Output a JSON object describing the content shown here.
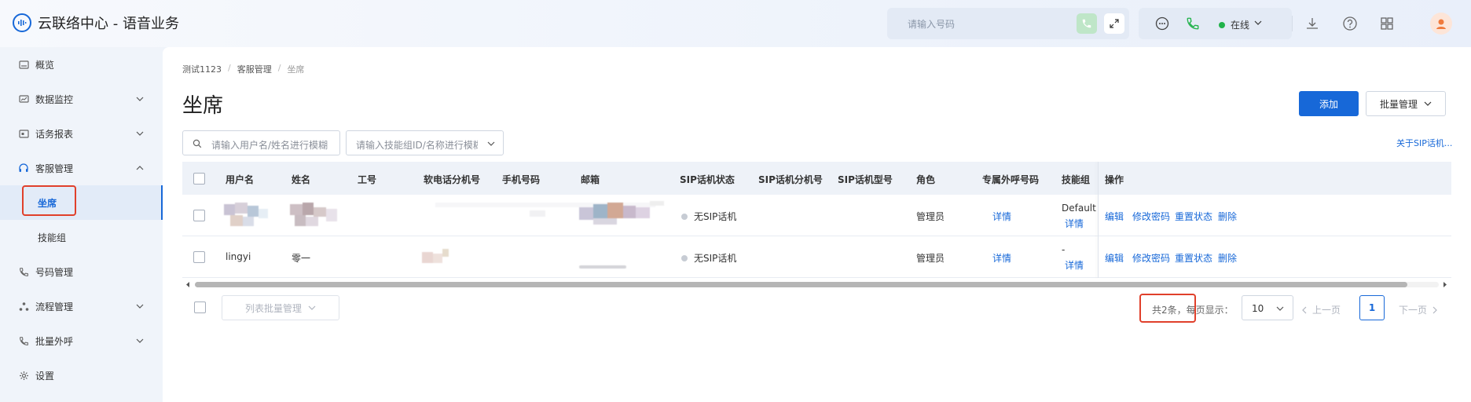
{
  "app": {
    "title": "云联络中心 - 语音业务"
  },
  "topbar": {
    "search_placeholder": "请输入号码",
    "status": "在线"
  },
  "sidebar": {
    "items": [
      {
        "label": "概览",
        "icon": "overview-icon"
      },
      {
        "label": "数据监控",
        "icon": "monitor-icon"
      },
      {
        "label": "话务报表",
        "icon": "report-icon"
      },
      {
        "label": "客服管理",
        "icon": "headset-icon"
      },
      {
        "label": "坐席"
      },
      {
        "label": "技能组"
      },
      {
        "label": "号码管理",
        "icon": "phone-icon"
      },
      {
        "label": "流程管理",
        "icon": "flow-icon"
      },
      {
        "label": "批量外呼",
        "icon": "outbound-icon"
      },
      {
        "label": "设置",
        "icon": "gear-icon"
      }
    ]
  },
  "breadcrumb": [
    "测试1123",
    "客服管理",
    "坐席"
  ],
  "page": {
    "title": "坐席",
    "add_label": "添加",
    "batch_label": "批量管理",
    "filter_user_placeholder": "请输入用户名/姓名进行模糊",
    "filter_skill_placeholder": "请输入技能组ID/名称进行模糊",
    "about_sip": "关于SIP话机..."
  },
  "table": {
    "headers": [
      "用户名",
      "姓名",
      "工号",
      "软电话分机号",
      "手机号码",
      "邮箱",
      "SIP话机状态",
      "SIP话机分机号",
      "SIP话机型号",
      "角色",
      "专属外呼号码",
      "技能组",
      "操作"
    ],
    "rows": [
      {
        "username": "",
        "name": "",
        "sip_status": "无SIP话机",
        "role": "管理员",
        "outbound": "详情",
        "skill_top": "Default",
        "skill_link": "详情",
        "ops": [
          "编辑",
          "修改密码",
          "重置状态",
          "删除"
        ]
      },
      {
        "username": "lingyi",
        "name": "零一",
        "sip_status": "无SIP话机",
        "role": "管理员",
        "outbound": "详情",
        "skill_top": "-",
        "skill_link": "详情",
        "ops": [
          "编辑",
          "修改密码",
          "重置状态",
          "删除"
        ]
      }
    ]
  },
  "footer": {
    "batch_label": "列表批量管理",
    "total": "共2条，每页显示：",
    "page_size": "10",
    "prev": "上一页",
    "current_page": "1",
    "next": "下一页"
  },
  "colors": {
    "primary": "#1768d8",
    "annotation": "#e0402b",
    "online": "#21b24a"
  }
}
